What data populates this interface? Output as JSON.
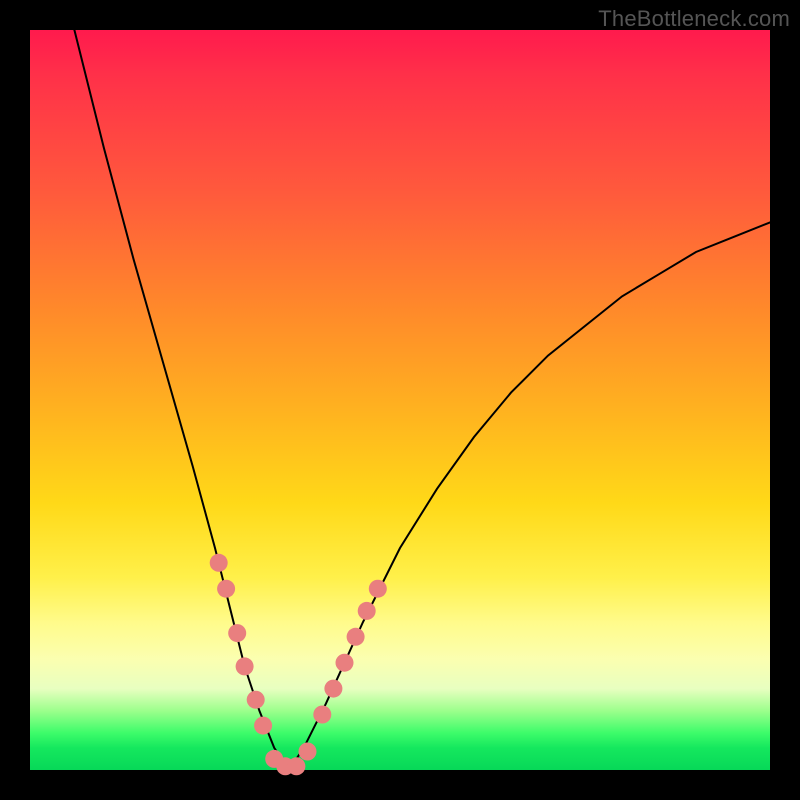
{
  "watermark": "TheBottleneck.com",
  "chart_data": {
    "type": "line",
    "title": "",
    "xlabel": "",
    "ylabel": "",
    "xlim": [
      0,
      100
    ],
    "ylim": [
      0,
      100
    ],
    "series": [
      {
        "name": "bottleneck-curve",
        "x": [
          6,
          10,
          14,
          18,
          22,
          25,
          27,
          29,
          31,
          33,
          35,
          37,
          40,
          45,
          50,
          55,
          60,
          65,
          70,
          75,
          80,
          85,
          90,
          95,
          100
        ],
        "values": [
          100,
          84,
          69,
          55,
          41,
          30,
          22,
          14,
          8,
          3,
          0,
          3,
          9,
          20,
          30,
          38,
          45,
          51,
          56,
          60,
          64,
          67,
          70,
          72,
          74
        ]
      }
    ],
    "markers": {
      "name": "highlight-dots",
      "color": "#e97f7f",
      "radius_px": 9,
      "x": [
        25.5,
        26.5,
        28.0,
        29.0,
        30.5,
        31.5,
        33.0,
        34.5,
        36.0,
        37.5,
        39.5,
        41.0,
        42.5,
        44.0,
        45.5,
        47.0
      ],
      "values": [
        28.0,
        24.5,
        18.5,
        14.0,
        9.5,
        6.0,
        1.5,
        0.5,
        0.5,
        2.5,
        7.5,
        11.0,
        14.5,
        18.0,
        21.5,
        24.5
      ]
    },
    "gradient_stops": [
      {
        "pos": 0.0,
        "color": "#ff1a4d"
      },
      {
        "pos": 0.22,
        "color": "#ff5a3c"
      },
      {
        "pos": 0.52,
        "color": "#ffb41f"
      },
      {
        "pos": 0.8,
        "color": "#fffb8a"
      },
      {
        "pos": 0.95,
        "color": "#3dfc6a"
      },
      {
        "pos": 1.0,
        "color": "#07d858"
      }
    ]
  }
}
